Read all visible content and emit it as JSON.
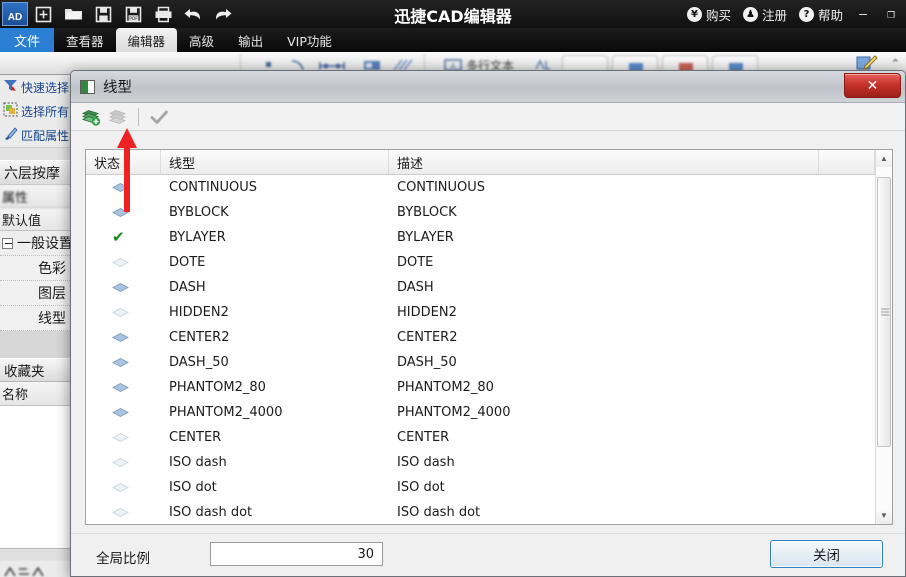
{
  "titlebar": {
    "logo": "AD",
    "app_title": "迅捷CAD编辑器",
    "quick_icons": [
      {
        "name": "new-file-icon",
        "glyph": "new"
      },
      {
        "name": "open-folder-icon",
        "glyph": "folder"
      },
      {
        "name": "save-icon",
        "glyph": "save"
      },
      {
        "name": "save-as-pdf-icon",
        "glyph": "savepdf"
      },
      {
        "name": "print-icon",
        "glyph": "print"
      },
      {
        "name": "undo-icon",
        "glyph": "undo"
      },
      {
        "name": "redo-icon",
        "glyph": "redo"
      }
    ],
    "actions": [
      {
        "name": "buy-button",
        "icon": "yen-icon",
        "symbol": "¥",
        "label": "购买"
      },
      {
        "name": "register-button",
        "icon": "user-icon",
        "symbol": "♟",
        "label": "注册"
      },
      {
        "name": "help-button",
        "icon": "question-icon",
        "symbol": "?",
        "label": "帮助"
      }
    ],
    "window_controls": [
      {
        "name": "minimize-button",
        "glyph": "—"
      },
      {
        "name": "maximize-button",
        "glyph": "❐"
      }
    ]
  },
  "ribbon": {
    "tabs": [
      {
        "name": "tab-file",
        "label": "文件",
        "state": "file"
      },
      {
        "name": "tab-viewer",
        "label": "查看器",
        "state": "normal"
      },
      {
        "name": "tab-editor",
        "label": "编辑器",
        "state": "active"
      },
      {
        "name": "tab-advanced",
        "label": "高级",
        "state": "normal"
      },
      {
        "name": "tab-output",
        "label": "输出",
        "state": "normal"
      },
      {
        "name": "tab-vip",
        "label": "VIP功能",
        "state": "normal"
      }
    ],
    "panel_partial_text": "多行文本"
  },
  "left_panel": {
    "commands": [
      {
        "name": "sidebar-item-quick-select",
        "label": "快速选择",
        "icon": "funnel-icon"
      },
      {
        "name": "sidebar-item-select-all",
        "label": "选择所有",
        "icon": "select-all-icon"
      },
      {
        "name": "sidebar-item-match-properties",
        "label": "匹配属性",
        "icon": "brush-icon"
      }
    ],
    "group_header": "六层按摩",
    "properties_header": "属性",
    "default_value_header": "默认值",
    "tree_node": "一般设置",
    "tree_children": [
      {
        "name": "sidebar-item-color",
        "label": "色彩"
      },
      {
        "name": "sidebar-item-layer",
        "label": "图层"
      },
      {
        "name": "sidebar-item-linetype",
        "label": "线型"
      }
    ],
    "favorites_header": "收藏夹",
    "name_column": "名称"
  },
  "dialog": {
    "title": "线型",
    "close_x": "✕",
    "toolbar": [
      {
        "name": "load-linetype-button",
        "icon": "add-linetype-icon",
        "enabled": true
      },
      {
        "name": "delete-linetype-button",
        "icon": "delete-linetype-icon",
        "enabled": false
      },
      {
        "name": "set-current-button",
        "icon": "checkmark-icon",
        "enabled": false
      }
    ],
    "columns": [
      "状态",
      "线型",
      "描述"
    ],
    "rows": [
      {
        "status": "layer",
        "linetype": "CONTINUOUS",
        "description": "CONTINUOUS"
      },
      {
        "status": "layer",
        "linetype": "BYBLOCK",
        "description": "BYBLOCK"
      },
      {
        "status": "check",
        "linetype": "BYLAYER",
        "description": "BYLAYER"
      },
      {
        "status": "pale",
        "linetype": "DOTE",
        "description": "DOTE"
      },
      {
        "status": "layer",
        "linetype": "DASH",
        "description": "DASH"
      },
      {
        "status": "pale",
        "linetype": "HIDDEN2",
        "description": "HIDDEN2"
      },
      {
        "status": "layer",
        "linetype": "CENTER2",
        "description": "CENTER2"
      },
      {
        "status": "layer",
        "linetype": "DASH_50",
        "description": "DASH_50"
      },
      {
        "status": "layer",
        "linetype": "PHANTOM2_80",
        "description": "PHANTOM2_80"
      },
      {
        "status": "layer",
        "linetype": "PHANTOM2_4000",
        "description": "PHANTOM2_4000"
      },
      {
        "status": "pale",
        "linetype": "CENTER",
        "description": "CENTER"
      },
      {
        "status": "pale",
        "linetype": "ISO dash",
        "description": "ISO dash"
      },
      {
        "status": "pale",
        "linetype": "ISO dot",
        "description": "ISO dot"
      },
      {
        "status": "pale",
        "linetype": "ISO dash dot",
        "description": "ISO dash dot"
      }
    ],
    "scrollbar": {
      "up": "▲",
      "down": "▼"
    },
    "footer": {
      "scale_label": "全局比例",
      "scale_value": "30",
      "close_label": "关闭"
    }
  },
  "annotation": {
    "name": "red-arrow-annotation",
    "color": "#ee2222"
  },
  "colors": {
    "titlebar_bg": "#141414",
    "file_tab": "#2a7fd4",
    "dialog_bg": "#f0f0f0",
    "close_red": "#c4312a",
    "check_green": "#138a1f",
    "accent_blue": "#2f7fc1",
    "sidebar_link": "#15458f"
  }
}
